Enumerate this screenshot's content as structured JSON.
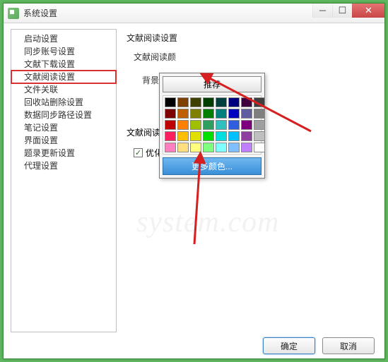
{
  "window": {
    "title": "系统设置"
  },
  "sidebar": {
    "items": [
      {
        "label": "启动设置"
      },
      {
        "label": "同步账号设置"
      },
      {
        "label": "文献下载设置"
      },
      {
        "label": "文献阅读设置",
        "selected": true
      },
      {
        "label": "文件关联"
      },
      {
        "label": "回收站删除设置"
      },
      {
        "label": "数据同步路径设置"
      },
      {
        "label": "笔记设置"
      },
      {
        "label": "界面设置"
      },
      {
        "label": "题录更新设置"
      },
      {
        "label": "代理设置"
      }
    ]
  },
  "main": {
    "section_title": "文献阅读设置",
    "color_section_title": "文献阅读颜",
    "bg_label": "背景",
    "read_label": "文献阅读",
    "optimize_label": "优化文",
    "optimize_checked": true
  },
  "color_picker": {
    "recommend": "推荐",
    "more": "更多颜色...",
    "swatches": [
      "#000000",
      "#7f3f00",
      "#3f3f00",
      "#003f00",
      "#003f3f",
      "#00007f",
      "#3f003f",
      "#3f3f3f",
      "#7f0000",
      "#bf5f00",
      "#7f7f00",
      "#007f00",
      "#007f7f",
      "#0000bf",
      "#5f5f9f",
      "#7f7f7f",
      "#bf0000",
      "#ff7f00",
      "#9fbf00",
      "#2f9f5f",
      "#2fbfbf",
      "#2f5fdf",
      "#7f007f",
      "#9f9f9f",
      "#ff1f5f",
      "#ffbf00",
      "#dfdf00",
      "#00df00",
      "#00dfdf",
      "#00bfff",
      "#8f3f9f",
      "#bfbfbf",
      "#ff7fbf",
      "#ffdf7f",
      "#ffff7f",
      "#7fff7f",
      "#7fffff",
      "#7fbfff",
      "#bf7fff",
      "#ffffff"
    ]
  },
  "footer": {
    "ok": "确定",
    "cancel": "取消"
  },
  "watermark": "system.com"
}
